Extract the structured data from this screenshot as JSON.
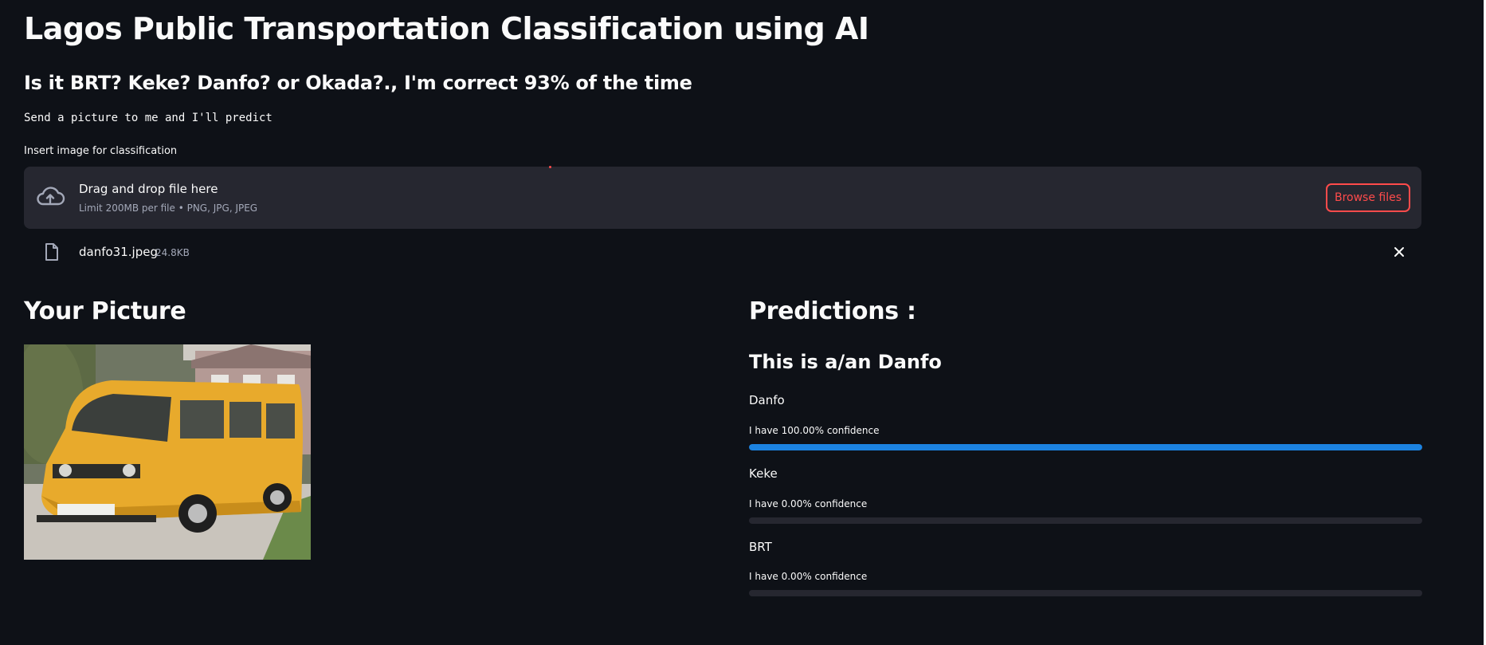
{
  "header": {
    "title": "Lagos Public Transportation Classification using AI",
    "subtitle": "Is it BRT? Keke? Danfo? or Okada?., I'm correct 93% of the time",
    "instruction": "Send a picture to me and I'll predict"
  },
  "uploader": {
    "label": "Insert image for classification",
    "drop_text": "Drag and drop file here",
    "limit_text": "Limit 200MB per file • PNG, JPG, JPEG",
    "browse_label": "Browse files",
    "file_name": "danfo31.jpeg",
    "file_size": "24.8KB"
  },
  "left": {
    "heading": "Your Picture"
  },
  "right": {
    "heading": "Predictions :",
    "result": "This is a/an Danfo",
    "predictions": [
      {
        "label": "Danfo",
        "confidence_text": "I have 100.00% confidence",
        "progress": 1.0
      },
      {
        "label": "Keke",
        "confidence_text": "I have 0.00% confidence",
        "progress": 0.0
      },
      {
        "label": "BRT",
        "confidence_text": "I have 0.00% confidence",
        "progress": 0.0
      }
    ]
  },
  "colors": {
    "background": "#0e1117",
    "panel": "#262730",
    "accent": "#ff4b4b",
    "progress": "#1c83e1",
    "muted_text": "#a3a8b8"
  },
  "icons": {
    "upload": "cloud-upload-icon",
    "file": "file-icon",
    "close": "close-icon"
  }
}
